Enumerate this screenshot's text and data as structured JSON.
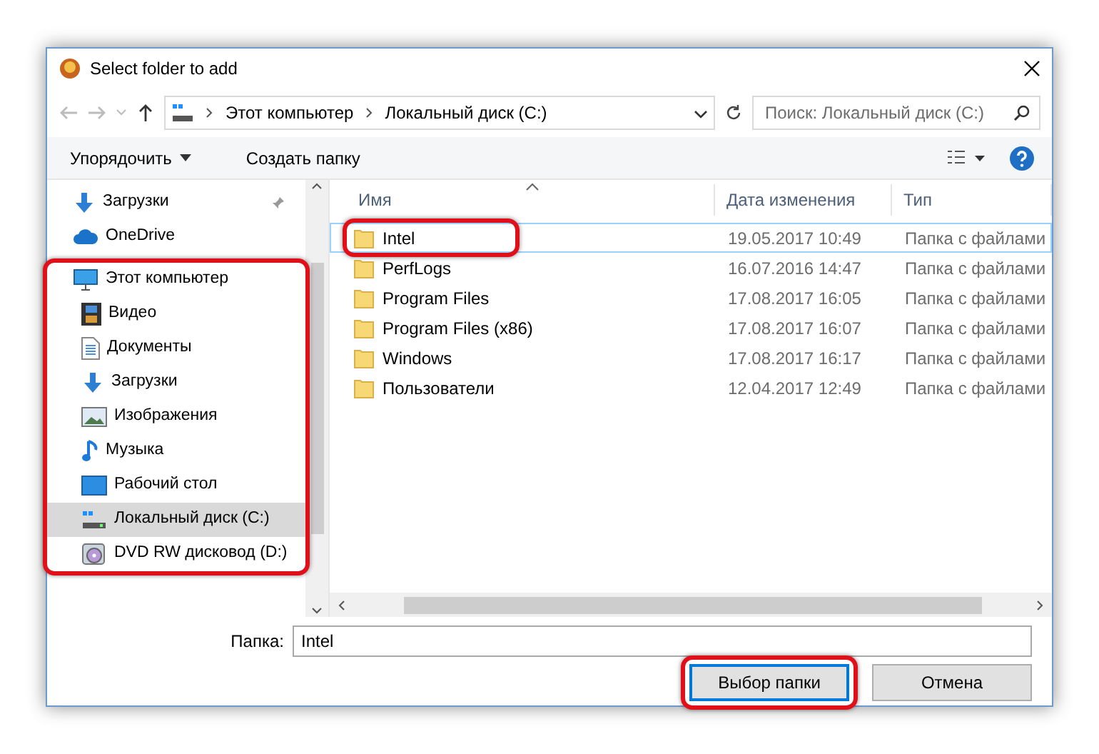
{
  "window": {
    "title": "Select folder to add"
  },
  "address_bar": {
    "path": [
      "Этот компьютер",
      "Локальный диск (C:)"
    ]
  },
  "search": {
    "placeholder": "Поиск: Локальный диск (C:)"
  },
  "toolbar": {
    "organize": "Упорядочить",
    "new_folder": "Создать папку"
  },
  "sidebar": {
    "items": [
      {
        "label": "Загрузки",
        "kind": "downloads",
        "pinned": true,
        "selected": false,
        "highlighted": false
      },
      {
        "label": "OneDrive",
        "kind": "cloud",
        "selected": false,
        "highlighted": false
      },
      {
        "label": "Этот компьютер",
        "kind": "computer",
        "selected": false,
        "highlighted": true,
        "children": [
          {
            "label": "Видео",
            "kind": "video",
            "selected": false
          },
          {
            "label": "Документы",
            "kind": "documents",
            "selected": false
          },
          {
            "label": "Загрузки",
            "kind": "downloads",
            "selected": false
          },
          {
            "label": "Изображения",
            "kind": "pictures",
            "selected": false
          },
          {
            "label": "Музыка",
            "kind": "music",
            "selected": false
          },
          {
            "label": "Рабочий стол",
            "kind": "desktop",
            "selected": false
          },
          {
            "label": "Локальный диск (C:)",
            "kind": "drive",
            "selected": true
          },
          {
            "label": "DVD RW дисковод (D:)",
            "kind": "dvd",
            "selected": false
          }
        ]
      }
    ]
  },
  "file_list": {
    "columns": [
      "Имя",
      "Дата изменения",
      "Тип"
    ],
    "rows": [
      {
        "name": "Intel",
        "modified": "19.05.2017 10:49",
        "type": "Папка с файлами",
        "selected": true,
        "highlighted": true
      },
      {
        "name": "PerfLogs",
        "modified": "16.07.2016 14:47",
        "type": "Папка с файлами",
        "selected": false,
        "highlighted": false
      },
      {
        "name": "Program Files",
        "modified": "17.08.2017 16:05",
        "type": "Папка с файлами",
        "selected": false,
        "highlighted": false
      },
      {
        "name": "Program Files (x86)",
        "modified": "17.08.2017 16:07",
        "type": "Папка с файлами",
        "selected": false,
        "highlighted": false
      },
      {
        "name": "Windows",
        "modified": "17.08.2017 16:17",
        "type": "Папка с файлами",
        "selected": false,
        "highlighted": false
      },
      {
        "name": "Пользователи",
        "modified": "12.04.2017 12:49",
        "type": "Папка с файлами",
        "selected": false,
        "highlighted": false
      }
    ]
  },
  "folder_field": {
    "label": "Папка:",
    "value": "Intel"
  },
  "buttons": [
    {
      "label": "Выбор папки",
      "kind": "primary",
      "highlighted": true
    },
    {
      "label": "Отмена",
      "kind": "secondary",
      "highlighted": false
    }
  ]
}
